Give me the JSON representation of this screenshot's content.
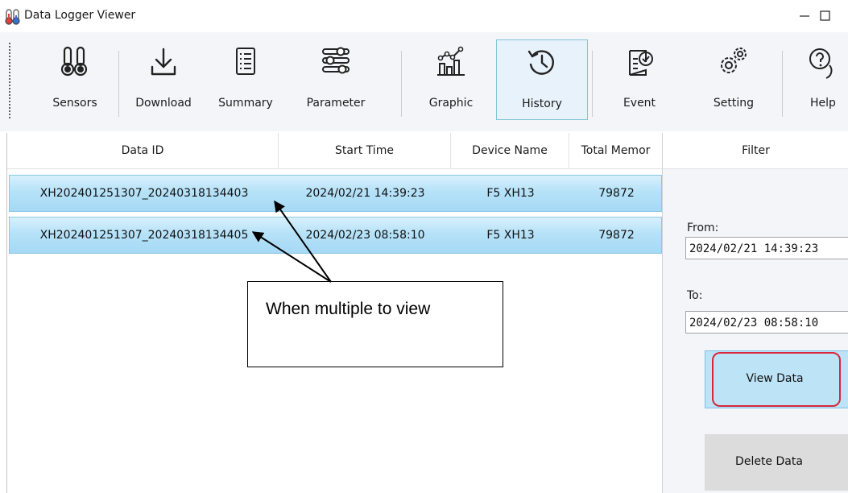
{
  "window": {
    "title": "Data Logger Viewer",
    "minimize_glyph": "—",
    "maximize_glyph": "☐"
  },
  "toolbar": {
    "items": [
      {
        "label": "Sensors",
        "icon": "thermometers-icon"
      },
      {
        "label": "Download",
        "icon": "download-icon"
      },
      {
        "label": "Summary",
        "icon": "summary-list-icon"
      },
      {
        "label": "Parameter",
        "icon": "sliders-icon"
      },
      {
        "label": "Graphic",
        "icon": "chart-icon"
      },
      {
        "label": "History",
        "icon": "history-icon",
        "active": true
      },
      {
        "label": "Event",
        "icon": "event-check-icon"
      },
      {
        "label": "Setting",
        "icon": "gears-icon"
      },
      {
        "label": "Help",
        "icon": "help-icon"
      }
    ]
  },
  "grid": {
    "columns": [
      "Data ID",
      "Start Time",
      "Device Name",
      "Total Memor"
    ],
    "rows": [
      {
        "data_id": "XH202401251307_20240318134403",
        "start_time": "2024/02/21 14:39:23",
        "device_name": "F5 XH13",
        "total_memory": "79872"
      },
      {
        "data_id": "XH202401251307_20240318134405",
        "start_time": "2024/02/23 08:58:10",
        "device_name": "F5 XH13",
        "total_memory": "79872"
      }
    ]
  },
  "annotation": {
    "text": "When multiple to view"
  },
  "filter": {
    "title": "Filter",
    "from_label": "From:",
    "from_value": "2024/02/21 14:39:23",
    "to_label": "To:",
    "to_value": "2024/02/23 08:58:10",
    "view_button": "View Data",
    "delete_button": "Delete Data"
  },
  "colors": {
    "row_selected": "#b6e2f8",
    "highlight_outline": "#d9263b",
    "toolbar_bg": "#f3f5f8"
  }
}
